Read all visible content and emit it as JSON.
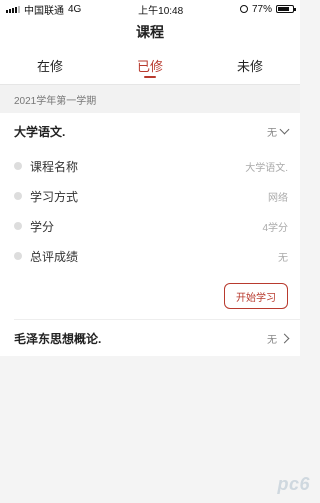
{
  "status_bar": {
    "carrier": "中国联通",
    "network": "4G",
    "time": "上午10:48",
    "battery": "77%",
    "battery_level": 0.77
  },
  "header": {
    "title": "课程"
  },
  "tabs": [
    {
      "label": "在修",
      "active": false
    },
    {
      "label": "已修",
      "active": true
    },
    {
      "label": "未修",
      "active": false
    }
  ],
  "semester": "2021学年第一学期",
  "courses": [
    {
      "title": "大学语文.",
      "status": "无",
      "expanded": true,
      "details": [
        {
          "label": "课程名称",
          "value": "大学语文."
        },
        {
          "label": "学习方式",
          "value": "网络"
        },
        {
          "label": "学分",
          "value": "4学分"
        },
        {
          "label": "总评成绩",
          "value": "无"
        }
      ],
      "action_label": "开始学习"
    },
    {
      "title": "毛泽东思想概论.",
      "status": "无",
      "expanded": false
    }
  ],
  "accent_color": "#b83a2e",
  "watermark": "pc6"
}
